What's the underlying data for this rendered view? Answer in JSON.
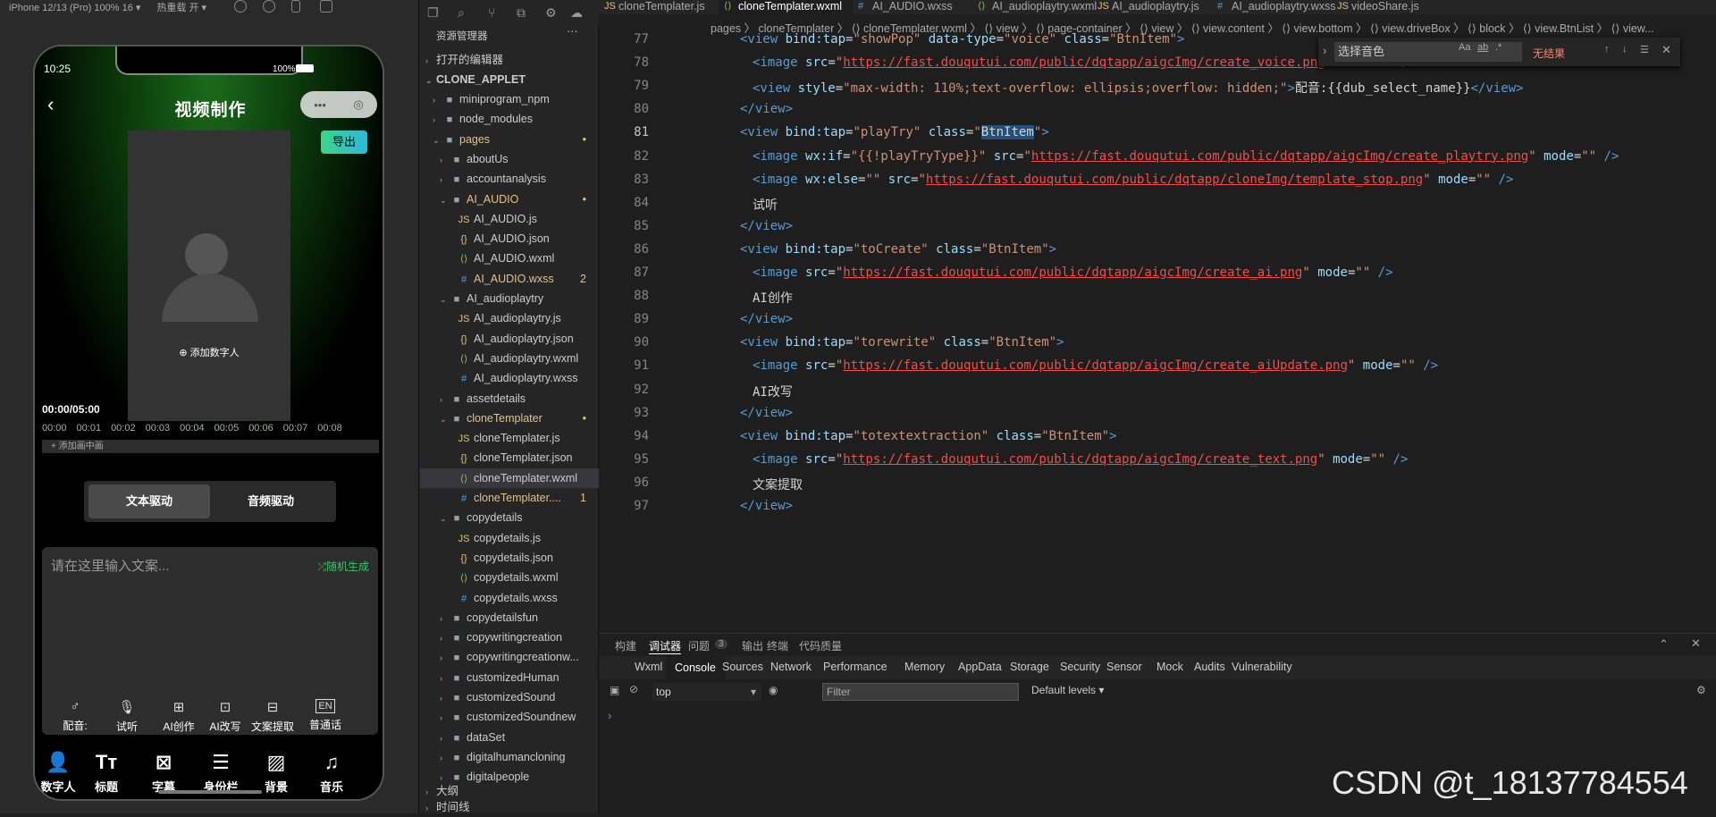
{
  "simulator": {
    "device": "iPhone 12/13 (Pro) 100% 16 ▾",
    "hot_reload": "热重载 开 ▾"
  },
  "phone": {
    "time": "10:25",
    "battery": "100%",
    "title": "视频制作",
    "capsule_more": "•••",
    "capsule_close": "◎",
    "export": "导出",
    "add_human": "⊕ 添加数字人",
    "timecode": "00:00/05:00",
    "ticks": [
      "00:00",
      "00:01",
      "00:02",
      "00:03",
      "00:04",
      "00:05",
      "00:06",
      "00:07",
      "00:08"
    ],
    "add_scene": "+   添加画中画",
    "drive_text": "文本驱动",
    "drive_audio": "音频驱动",
    "placeholder": "请在这里输入文案...",
    "random": "⤮随机生成",
    "tools": [
      {
        "icon": "♂",
        "label": "配音:"
      },
      {
        "icon": "🎙",
        "label": "试听"
      },
      {
        "icon": "⊞",
        "label": "AI创作"
      },
      {
        "icon": "⊡",
        "label": "AI改写"
      },
      {
        "icon": "⊟",
        "label": "文案提取"
      },
      {
        "icon": "EN",
        "label": "普通话"
      }
    ],
    "tabs": [
      {
        "icon": "👤",
        "label": "数字人"
      },
      {
        "icon": "Tт",
        "label": "标题"
      },
      {
        "icon": "⊠",
        "label": "字幕"
      },
      {
        "icon": "☰",
        "label": "身份栏"
      },
      {
        "icon": "▨",
        "label": "背景"
      },
      {
        "icon": "♫",
        "label": "音乐"
      }
    ]
  },
  "explorer": {
    "title": "资源管理器",
    "open_editors": "打开的编辑器",
    "root": "CLONE_APPLET",
    "items": [
      {
        "label": "miniprogram_npm",
        "type": "folder",
        "depth": 1,
        "open": false
      },
      {
        "label": "node_modules",
        "type": "folder",
        "depth": 1,
        "open": false
      },
      {
        "label": "pages",
        "type": "folder",
        "depth": 1,
        "open": true,
        "badge": "•"
      },
      {
        "label": "aboutUs",
        "type": "folder",
        "depth": 2,
        "open": false
      },
      {
        "label": "accountanalysis",
        "type": "folder",
        "depth": 2,
        "open": false
      },
      {
        "label": "AI_AUDIO",
        "type": "folder",
        "depth": 2,
        "open": true,
        "badge": "•"
      },
      {
        "label": "AI_AUDIO.js",
        "type": "js",
        "depth": 3
      },
      {
        "label": "AI_AUDIO.json",
        "type": "json",
        "depth": 3
      },
      {
        "label": "AI_AUDIO.wxml",
        "type": "wxml",
        "depth": 3
      },
      {
        "label": "AI_AUDIO.wxss",
        "type": "wxss",
        "depth": 3,
        "badge": "2"
      },
      {
        "label": "AI_audioplaytry",
        "type": "folder",
        "depth": 2,
        "open": true
      },
      {
        "label": "AI_audioplaytry.js",
        "type": "js",
        "depth": 3
      },
      {
        "label": "AI_audioplaytry.json",
        "type": "json",
        "depth": 3
      },
      {
        "label": "AI_audioplaytry.wxml",
        "type": "wxml",
        "depth": 3
      },
      {
        "label": "AI_audioplaytry.wxss",
        "type": "wxss",
        "depth": 3
      },
      {
        "label": "assetdetails",
        "type": "folder",
        "depth": 2,
        "open": false
      },
      {
        "label": "cloneTemplater",
        "type": "folder",
        "depth": 2,
        "open": true,
        "badge": "•"
      },
      {
        "label": "cloneTemplater.js",
        "type": "js",
        "depth": 3
      },
      {
        "label": "cloneTemplater.json",
        "type": "json",
        "depth": 3
      },
      {
        "label": "cloneTemplater.wxml",
        "type": "wxml",
        "depth": 3,
        "selected": true
      },
      {
        "label": "cloneTemplater....",
        "type": "wxss",
        "depth": 3,
        "badge": "1"
      },
      {
        "label": "copydetails",
        "type": "folder",
        "depth": 2,
        "open": true
      },
      {
        "label": "copydetails.js",
        "type": "js",
        "depth": 3
      },
      {
        "label": "copydetails.json",
        "type": "json",
        "depth": 3
      },
      {
        "label": "copydetails.wxml",
        "type": "wxml",
        "depth": 3
      },
      {
        "label": "copydetails.wxss",
        "type": "wxss",
        "depth": 3
      },
      {
        "label": "copydetailsfun",
        "type": "folder",
        "depth": 2,
        "open": false
      },
      {
        "label": "copywritingcreation",
        "type": "folder",
        "depth": 2,
        "open": false
      },
      {
        "label": "copywritingcreationw...",
        "type": "folder",
        "depth": 2,
        "open": false
      },
      {
        "label": "customizedHuman",
        "type": "folder",
        "depth": 2,
        "open": false
      },
      {
        "label": "customizedSound",
        "type": "folder",
        "depth": 2,
        "open": false
      },
      {
        "label": "customizedSoundnew",
        "type": "folder",
        "depth": 2,
        "open": false
      },
      {
        "label": "dataSet",
        "type": "folder",
        "depth": 2,
        "open": false
      },
      {
        "label": "digitalhumancloning",
        "type": "folder",
        "depth": 2,
        "open": false
      },
      {
        "label": "digitalpeople",
        "type": "folder",
        "depth": 2,
        "open": false
      }
    ],
    "outline": "大纲",
    "timeline": "时间线"
  },
  "editor": {
    "tabs": [
      {
        "label": "cloneTemplater.js",
        "type": "js"
      },
      {
        "label": "cloneTemplater.wxml",
        "type": "wxml",
        "active": true
      },
      {
        "label": "AI_AUDIO.wxss",
        "type": "wxss"
      },
      {
        "label": "AI_audioplaytry.wxml",
        "type": "wxml"
      },
      {
        "label": "AI_audioplaytry.js",
        "type": "js"
      },
      {
        "label": "AI_audioplaytry.wxss",
        "type": "wxss"
      },
      {
        "label": "videoShare.js",
        "type": "js"
      }
    ],
    "breadcrumb": "pages 〉 cloneTemplater 〉 ⟨⟩ cloneTemplater.wxml 〉 ⟨⟩ view 〉 ⟨⟩ page-container 〉 ⟨⟩ view 〉 ⟨⟩ view.content 〉 ⟨⟩ view.bottom 〉 ⟨⟩ view.driveBox 〉 ⟨⟩ block 〉 ⟨⟩ view.BtnList 〉 ⟨⟩ view...",
    "find": {
      "value": "选择音色",
      "result": "无结果"
    },
    "lines": [
      {
        "n": "77",
        "i": 0,
        "t": [
          [
            "tg",
            "<view "
          ],
          [
            "at",
            "bind:tap"
          ],
          [
            "mu",
            "="
          ],
          [
            "sv",
            "\"showPop\""
          ],
          [
            "at",
            " data-type"
          ],
          [
            "mu",
            "="
          ],
          [
            "sv",
            "\"voice\""
          ],
          [
            "at",
            " class"
          ],
          [
            "mu",
            "="
          ],
          [
            "sv",
            "\"BtnItem\""
          ],
          [
            "tg",
            ">"
          ]
        ]
      },
      {
        "n": "78",
        "i": 1,
        "t": [
          [
            "tg",
            "<image "
          ],
          [
            "at",
            "src"
          ],
          [
            "mu",
            "="
          ],
          [
            "sv",
            "\""
          ],
          [
            "ur",
            "https://fast.douqutui.com/public/dqtapp/aigcImg/create_voice.png"
          ],
          [
            "sv",
            "\""
          ],
          [
            "at",
            " mode"
          ],
          [
            "mu",
            "="
          ],
          [
            "sv",
            "\"\""
          ],
          [
            "tg",
            " />"
          ]
        ]
      },
      {
        "n": "79",
        "i": 1,
        "t": [
          [
            "tg",
            "<view "
          ],
          [
            "at",
            "style"
          ],
          [
            "mu",
            "="
          ],
          [
            "sv",
            "\"max-width: 110%;text-overflow: ellipsis;overflow: hidden;\""
          ],
          [
            "tg",
            ">"
          ],
          [
            "mu",
            "配音:{{dub_select_name}}"
          ],
          [
            "tg",
            "</view>"
          ]
        ]
      },
      {
        "n": "80",
        "i": 0,
        "t": [
          [
            "tg",
            "</view>"
          ]
        ]
      },
      {
        "n": "81",
        "i": 0,
        "t": [
          [
            "tg",
            "<view "
          ],
          [
            "at",
            "bind:tap"
          ],
          [
            "mu",
            "="
          ],
          [
            "sv",
            "\"playTry\""
          ],
          [
            "at",
            " class"
          ],
          [
            "mu",
            "="
          ],
          [
            "sv",
            "\""
          ],
          [
            "hl",
            "BtnItem"
          ],
          [
            "sv",
            "\""
          ],
          [
            "tg",
            ">"
          ]
        ]
      },
      {
        "n": "82",
        "i": 1,
        "t": [
          [
            "tg",
            "<image "
          ],
          [
            "at",
            "wx:if"
          ],
          [
            "mu",
            "="
          ],
          [
            "sv",
            "\"{{!playTryType}}\""
          ],
          [
            "at",
            " src"
          ],
          [
            "mu",
            "="
          ],
          [
            "sv",
            "\""
          ],
          [
            "ur",
            "https://fast.douqutui.com/public/dqtapp/aigcImg/create_playtry.png"
          ],
          [
            "sv",
            "\""
          ],
          [
            "at",
            " mode"
          ],
          [
            "mu",
            "="
          ],
          [
            "sv",
            "\"\""
          ],
          [
            "tg",
            " />"
          ]
        ]
      },
      {
        "n": "83",
        "i": 1,
        "t": [
          [
            "tg",
            "<image "
          ],
          [
            "at",
            "wx:else"
          ],
          [
            "mu",
            "="
          ],
          [
            "sv",
            "\"\""
          ],
          [
            "at",
            " src"
          ],
          [
            "mu",
            "="
          ],
          [
            "sv",
            "\""
          ],
          [
            "ur",
            "https://fast.douqutui.com/public/dqtapp/cloneImg/template_stop.png"
          ],
          [
            "sv",
            "\""
          ],
          [
            "at",
            " mode"
          ],
          [
            "mu",
            "="
          ],
          [
            "sv",
            "\"\""
          ],
          [
            "tg",
            " />"
          ]
        ]
      },
      {
        "n": "84",
        "i": 1,
        "t": [
          [
            "mu",
            "试听"
          ]
        ]
      },
      {
        "n": "85",
        "i": 0,
        "t": [
          [
            "tg",
            "</view>"
          ]
        ]
      },
      {
        "n": "86",
        "i": 0,
        "t": [
          [
            "tg",
            "<view "
          ],
          [
            "at",
            "bind:tap"
          ],
          [
            "mu",
            "="
          ],
          [
            "sv",
            "\"toCreate\""
          ],
          [
            "at",
            " class"
          ],
          [
            "mu",
            "="
          ],
          [
            "sv",
            "\"BtnItem\""
          ],
          [
            "tg",
            ">"
          ]
        ]
      },
      {
        "n": "87",
        "i": 1,
        "t": [
          [
            "tg",
            "<image "
          ],
          [
            "at",
            "src"
          ],
          [
            "mu",
            "="
          ],
          [
            "sv",
            "\""
          ],
          [
            "ur",
            "https://fast.douqutui.com/public/dqtapp/aigcImg/create_ai.png"
          ],
          [
            "sv",
            "\""
          ],
          [
            "at",
            " mode"
          ],
          [
            "mu",
            "="
          ],
          [
            "sv",
            "\"\""
          ],
          [
            "tg",
            " />"
          ]
        ]
      },
      {
        "n": "88",
        "i": 1,
        "t": [
          [
            "mu",
            "AI创作"
          ]
        ]
      },
      {
        "n": "89",
        "i": 0,
        "t": [
          [
            "tg",
            "</view>"
          ]
        ]
      },
      {
        "n": "90",
        "i": 0,
        "t": [
          [
            "tg",
            "<view "
          ],
          [
            "at",
            "bind:tap"
          ],
          [
            "mu",
            "="
          ],
          [
            "sv",
            "\"torewrite\""
          ],
          [
            "at",
            " class"
          ],
          [
            "mu",
            "="
          ],
          [
            "sv",
            "\"BtnItem\""
          ],
          [
            "tg",
            ">"
          ]
        ]
      },
      {
        "n": "91",
        "i": 1,
        "t": [
          [
            "tg",
            "<image "
          ],
          [
            "at",
            "src"
          ],
          [
            "mu",
            "="
          ],
          [
            "sv",
            "\""
          ],
          [
            "ur",
            "https://fast.douqutui.com/public/dqtapp/aigcImg/create_aiUpdate.png"
          ],
          [
            "sv",
            "\""
          ],
          [
            "at",
            " mode"
          ],
          [
            "mu",
            "="
          ],
          [
            "sv",
            "\"\""
          ],
          [
            "tg",
            " />"
          ]
        ]
      },
      {
        "n": "92",
        "i": 1,
        "t": [
          [
            "mu",
            "AI改写"
          ]
        ]
      },
      {
        "n": "93",
        "i": 0,
        "t": [
          [
            "tg",
            "</view>"
          ]
        ]
      },
      {
        "n": "94",
        "i": 0,
        "t": [
          [
            "tg",
            "<view "
          ],
          [
            "at",
            "bind:tap"
          ],
          [
            "mu",
            "="
          ],
          [
            "sv",
            "\"totextextraction\""
          ],
          [
            "at",
            " class"
          ],
          [
            "mu",
            "="
          ],
          [
            "sv",
            "\"BtnItem\""
          ],
          [
            "tg",
            ">"
          ]
        ]
      },
      {
        "n": "95",
        "i": 1,
        "t": [
          [
            "tg",
            "<image "
          ],
          [
            "at",
            "src"
          ],
          [
            "mu",
            "="
          ],
          [
            "sv",
            "\""
          ],
          [
            "ur",
            "https://fast.douqutui.com/public/dqtapp/aigcImg/create_text.png"
          ],
          [
            "sv",
            "\""
          ],
          [
            "at",
            " mode"
          ],
          [
            "mu",
            "="
          ],
          [
            "sv",
            "\"\""
          ],
          [
            "tg",
            " />"
          ]
        ]
      },
      {
        "n": "96",
        "i": 1,
        "t": [
          [
            "mu",
            "文案提取"
          ]
        ]
      },
      {
        "n": "97",
        "i": 0,
        "t": [
          [
            "tg",
            "</view>"
          ]
        ]
      }
    ]
  },
  "panel": {
    "tabs": [
      {
        "label": "构建"
      },
      {
        "label": "调试器",
        "on": true
      },
      {
        "label": "问题"
      },
      {
        "label": "3"
      },
      {
        "label": "输出"
      },
      {
        "label": "终端"
      },
      {
        "label": "代码质量"
      }
    ],
    "devtabs": [
      {
        "label": "Wxml"
      },
      {
        "label": "Console",
        "on": true
      },
      {
        "label": "Sources"
      },
      {
        "label": "Network"
      },
      {
        "label": "Performance"
      },
      {
        "label": "Memory"
      },
      {
        "label": "AppData"
      },
      {
        "label": "Storage"
      },
      {
        "label": "Security"
      },
      {
        "label": "Sensor"
      },
      {
        "label": "Mock"
      },
      {
        "label": "Audits"
      },
      {
        "label": "Vulnerability"
      }
    ],
    "context": "top",
    "filter": "Filter",
    "levels": "Default levels ▾",
    "prompt": "›"
  },
  "watermark": "CSDN @t_18137784554",
  "colors": {
    "accent": "#3ec36b",
    "export_from": "#3bd68a",
    "export_to": "#2fb7d8",
    "tag": "#569cd6",
    "attr": "#9cdcfe",
    "string": "#ce9178",
    "url": "#f14c4c"
  }
}
